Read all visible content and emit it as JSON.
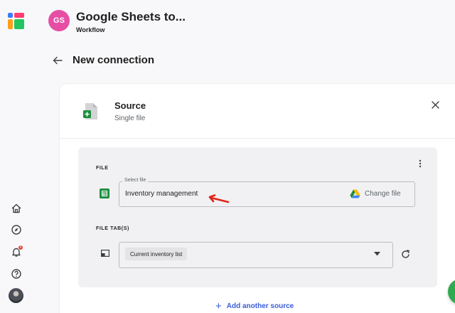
{
  "header": {
    "workspace_initials": "GS",
    "workspace_title": "Google Sheets to...",
    "workspace_subtitle": "Workflow"
  },
  "page": {
    "title": "New connection"
  },
  "source": {
    "title": "Source",
    "subtitle": "Single file",
    "file_section_label": "FILE",
    "file_field_label": "Select file",
    "file_value": "Inventory management",
    "change_file_label": "Change file",
    "tab_section_label": "FILE TAB(S)",
    "tab_selected": "Current inventory list",
    "add_source_label": "Add another source"
  },
  "sidebar": {
    "icons": [
      "app-logo-icon",
      "home-icon",
      "compass-icon",
      "bell-icon",
      "help-icon",
      "user-avatar"
    ],
    "notification_count": "6"
  },
  "colors": {
    "workspace_avatar": "#e64ea5",
    "accent_link": "#3b5bdb",
    "sheets_green": "#1e8e3e",
    "annotation_arrow": "#e0241b",
    "fab_green": "#2faa4f"
  }
}
